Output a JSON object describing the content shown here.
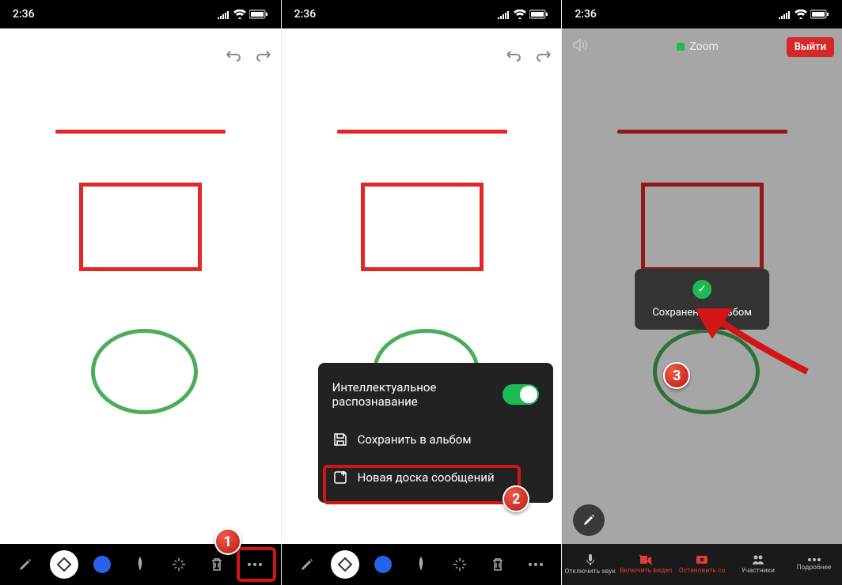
{
  "status": {
    "time": "2:36"
  },
  "step_labels": {
    "one": "1",
    "two": "2",
    "three": "3"
  },
  "wb_tools": {
    "pencil": "pencil-icon",
    "eraser": "eraser-icon",
    "color": "color-picker",
    "stylus": "stylus-icon",
    "wand": "wand-icon",
    "trash": "trash-icon",
    "more": "more-icon"
  },
  "popup": {
    "smart_recognition": "Интеллектуальное распознавание",
    "save_to_album": "Сохранить в альбом",
    "new_board": "Новая доска сообщений"
  },
  "zoom": {
    "title": "Zoom",
    "leave": "Выйти"
  },
  "toast": {
    "message": "Сохранено в альбом"
  },
  "zoom_bottom": {
    "mute": "Отключить звук",
    "video": "Включить видео",
    "stop": "Остановить со",
    "participants": "Участники",
    "more": "Подробнее"
  },
  "colors": {
    "accent_red": "#e22727",
    "accent_green": "#4aad5a",
    "accent_blue": "#2563eb",
    "toggle_green": "#1db954",
    "badge_red": "#b81b10"
  }
}
